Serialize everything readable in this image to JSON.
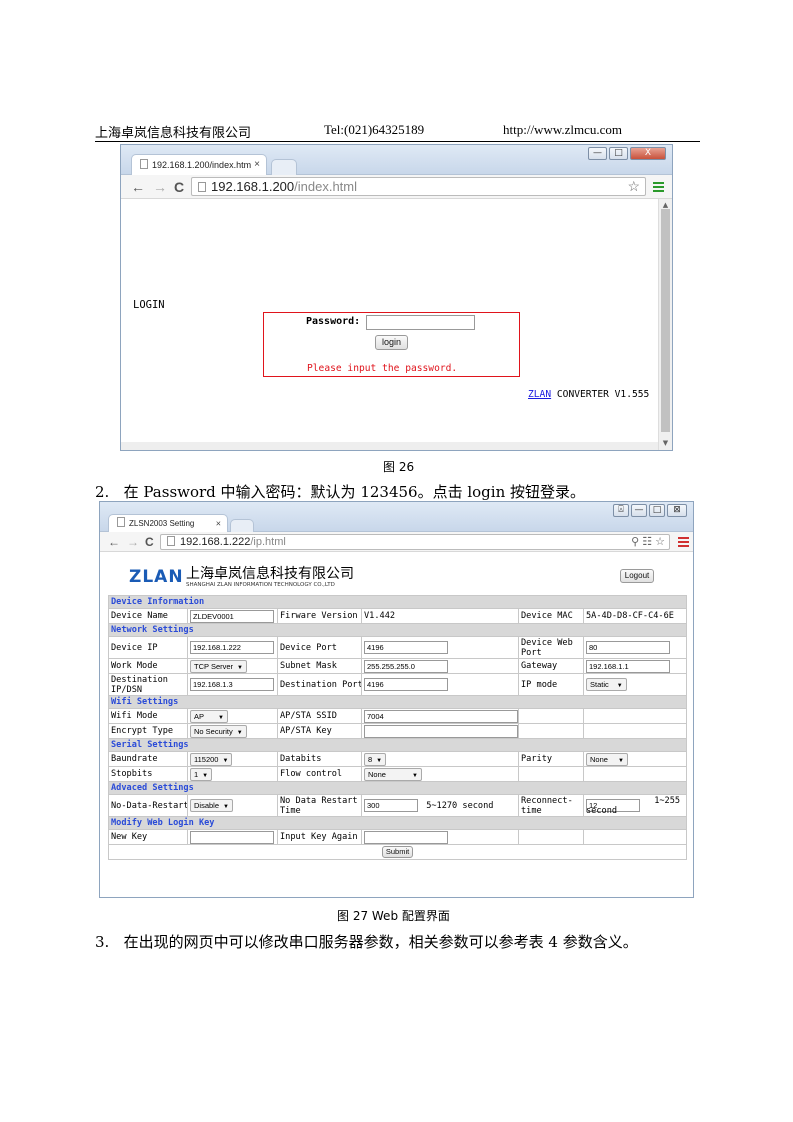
{
  "header": {
    "company": "上海卓岚信息科技有限公司",
    "tel": "Tel:(021)64325189",
    "url": "http://www.zlmcu.com"
  },
  "figure26": {
    "tab_title": "192.168.1.200/index.htm",
    "tab_close": "×",
    "url_host": "192.168.1.200",
    "url_path": "/index.html",
    "nav_back": "←",
    "nav_forward": "→",
    "nav_reload": "C",
    "star": "☆",
    "login_label": "LOGIN",
    "password_label": "Password:",
    "password_value": "",
    "login_button": "login",
    "message": "Please input the password.",
    "brand_link": "ZLAN",
    "version_text": "CONVERTER V1.555",
    "scroll_up": "▲",
    "scroll_down": "▼",
    "win_min": "—",
    "win_max": "□",
    "win_close": "X",
    "caption": "图 26"
  },
  "step2": "2.   在 Password 中输入密码：默认为 123456。点击 login 按钮登录。",
  "figure27": {
    "tab_title": "ZLSN2003 Setting",
    "tab_close": "×",
    "url_host": "192.168.1.222",
    "url_path": "/ip.html",
    "nav_back": "←",
    "nav_forward": "→",
    "nav_reload": "C",
    "toolbar_icons": "⚲ ☷ ☆",
    "logo": "ZLAN",
    "company_cn": "上海卓岚信息科技有限公司",
    "company_en": "SHANGHAI  ZLAN  INFORMATION TECHNOLOGY CO.,LTD",
    "logout_button": "Logout",
    "win_user": "⍓",
    "win_min": "—",
    "win_max": "□",
    "win_close": "⊠",
    "sections": {
      "device": "Device Information",
      "network": "Network Settings",
      "wifi": "Wifi Settings",
      "serial": "Serial Settings",
      "advanced": "Advaced Settings",
      "login_key": "Modify Web Login Key"
    },
    "device": {
      "name_label": "Device Name",
      "name_value": "ZLDEV0001",
      "fw_label": "Firware Version",
      "fw_value": "V1.442",
      "mac_label": "Device MAC",
      "mac_value": "5A-4D-D8-CF-C4-6E"
    },
    "network": {
      "ip_label": "Device IP",
      "ip_value": "192.168.1.222",
      "port_label": "Device Port",
      "port_value": "4196",
      "webport_label": "Device Web Port",
      "webport_value": "80",
      "mode_label": "Work Mode",
      "mode_value": "TCP Server",
      "mask_label": "Subnet Mask",
      "mask_value": "255.255.255.0",
      "gw_label": "Gateway",
      "gw_value": "192.168.1.1",
      "dest_label": "Destination IP/DSN",
      "dest_value": "192.168.1.3",
      "dport_label": "Destination Port",
      "dport_value": "4196",
      "ipmode_label": "IP mode",
      "ipmode_value": "Static"
    },
    "wifi": {
      "mode_label": "Wifi Mode",
      "mode_value": "AP",
      "ssid_label": "AP/STA SSID",
      "ssid_value": "7004",
      "enc_label": "Encrypt Type",
      "enc_value": "No Security",
      "key_label": "AP/STA Key",
      "key_value": ""
    },
    "serial": {
      "baud_label": "Baundrate",
      "baud_value": "115200",
      "databits_label": "Databits",
      "databits_value": "8",
      "parity_label": "Parity",
      "parity_value": "None",
      "stop_label": "Stopbits",
      "stop_value": "1",
      "flow_label": "Flow control",
      "flow_value": "None"
    },
    "advanced": {
      "ndr_label": "No-Data-Restart",
      "ndr_value": "Disable",
      "ndrt_label": "No Data Restart Time",
      "ndrt_value": "300",
      "ndrt_range": "5~1270 second",
      "reconn_label": "Reconnect-time",
      "reconn_value": "12",
      "reconn_range": "1~255",
      "reconn_unit": "second"
    },
    "login_key": {
      "new_label": "New Key",
      "new_value": "",
      "again_label": "Input Key Again",
      "again_value": ""
    },
    "submit_button": "Submit",
    "caption": "图 27 Web 配置界面"
  },
  "step3": "3.   在出现的网页中可以修改串口服务器参数，相关参数可以参考表 4 参数含义。",
  "colors": {
    "section_text": "#2a4bd8",
    "login_border": "#e0141c",
    "logo_blue": "#1a5bb5",
    "menu_green": "#2b9a2b",
    "menu_red": "#d03030"
  }
}
